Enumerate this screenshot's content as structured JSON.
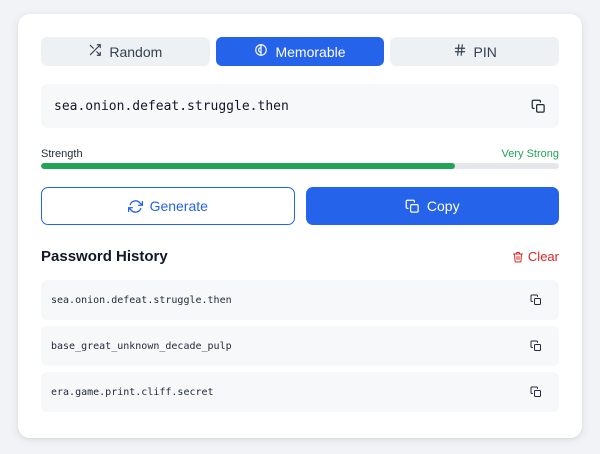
{
  "tabs": [
    {
      "label": "Random",
      "icon": "shuffle-icon",
      "active": false
    },
    {
      "label": "Memorable",
      "icon": "brain-icon",
      "active": true
    },
    {
      "label": "PIN",
      "icon": "hash-icon",
      "active": false
    }
  ],
  "password": {
    "value": "sea.onion.defeat.struggle.then"
  },
  "strength": {
    "label": "Strength",
    "value": "Very Strong",
    "percent": 80,
    "color": "#22a35a"
  },
  "actions": {
    "generate_label": "Generate",
    "copy_label": "Copy"
  },
  "history": {
    "title": "Password History",
    "clear_label": "Clear",
    "items": [
      "sea.onion.defeat.struggle.then",
      "base_great_unknown_decade_pulp",
      "era.game.print.cliff.secret"
    ]
  },
  "colors": {
    "accent": "#2563eb",
    "danger": "#dc2626",
    "success": "#22a35a"
  }
}
